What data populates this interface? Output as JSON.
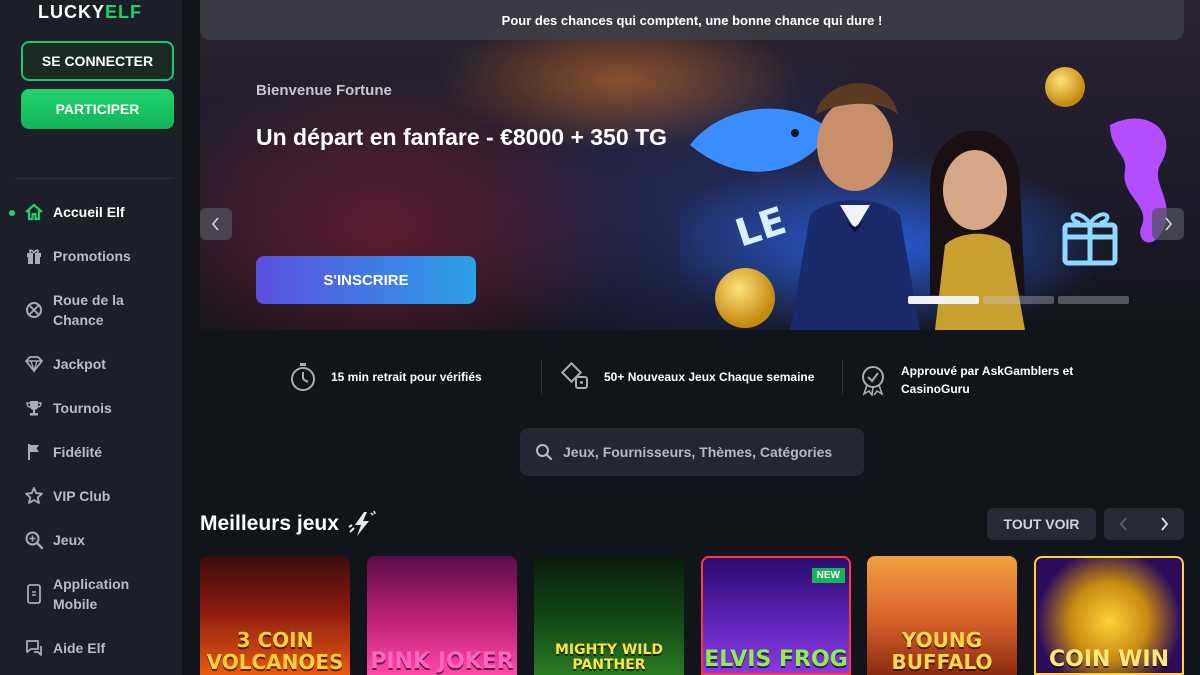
{
  "brand": {
    "logo_left": "LUCKY",
    "logo_right": "ELF"
  },
  "sidebar": {
    "login_label": "SE CONNECTER",
    "join_label": "PARTICIPER",
    "items": [
      {
        "label": "Accueil Elf",
        "icon": "home-icon",
        "active": true
      },
      {
        "label": "Promotions",
        "icon": "gift-icon"
      },
      {
        "label": "Roue de la Chance",
        "icon": "wheel-icon"
      },
      {
        "label": "Jackpot",
        "icon": "diamond-icon"
      },
      {
        "label": "Tournois",
        "icon": "trophy-icon"
      },
      {
        "label": "Fidélité",
        "icon": "flag-icon"
      },
      {
        "label": "VIP Club",
        "icon": "star-icon"
      },
      {
        "label": "Jeux",
        "icon": "search-icon"
      },
      {
        "label": "Application Mobile",
        "icon": "mobile-icon"
      },
      {
        "label": "Aide Elf",
        "icon": "chat-icon"
      }
    ]
  },
  "hero": {
    "banner": "Pour des chances qui comptent, une bonne chance qui dure !",
    "subtitle": "Bienvenue Fortune",
    "title": "Un départ en fanfare - €8000 + 350 TG",
    "cta": "S'INSCRIRE",
    "art_logo": "LE",
    "slide_count": 3,
    "active_slide": 1
  },
  "features": [
    {
      "icon": "stopwatch-icon",
      "text": "15 min retrait pour vérifiés"
    },
    {
      "icon": "dice-icon",
      "text": "50+ Nouveaux Jeux Chaque semaine"
    },
    {
      "icon": "badge-check-icon",
      "text": "Approuvé par AskGamblers et CasinoGuru"
    }
  ],
  "search": {
    "placeholder": "Jeux, Fournisseurs, Thèmes, Catégories"
  },
  "games_section": {
    "title": "Meilleurs jeux",
    "see_all": "TOUT VOIR",
    "games": [
      {
        "name": "3 COIN VOLCANOES"
      },
      {
        "name": "PINK JOKER"
      },
      {
        "name": "MIGHTY WILD PANTHER"
      },
      {
        "name": "ELVIS FROG",
        "badge": "NEW"
      },
      {
        "name": "YOUNG BUFFALO"
      },
      {
        "name": "COIN WIN"
      }
    ]
  },
  "colors": {
    "accent_green": "#1fd26a",
    "cta_start": "#5b4fe0",
    "cta_end": "#2aa0e8",
    "bg": "#12141c",
    "sidebar": "#1c1f29"
  }
}
